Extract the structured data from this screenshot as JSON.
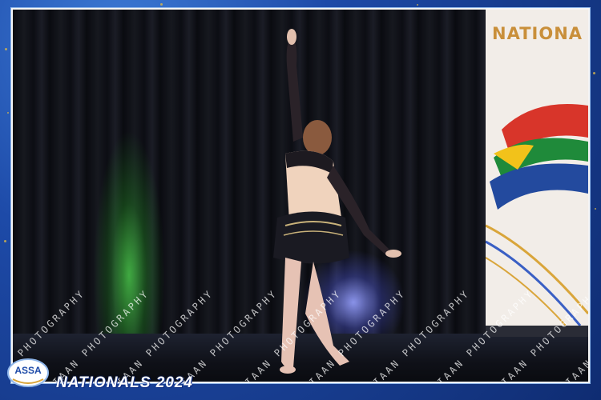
{
  "frame": {
    "event_title": "NATIONALS 2024",
    "logo_text": "ASSA"
  },
  "banner": {
    "word": "NATIONA"
  },
  "watermark": {
    "text": "WIAAN PHOTOGRAPHY"
  },
  "colors": {
    "frame_blue": "#1d4aa8",
    "gold_accent": "#c98f3a",
    "curtain": "#0a0b10",
    "green_light": "#50dc50",
    "blue_light": "#9696ff"
  },
  "image": {
    "subject": "dancer"
  }
}
